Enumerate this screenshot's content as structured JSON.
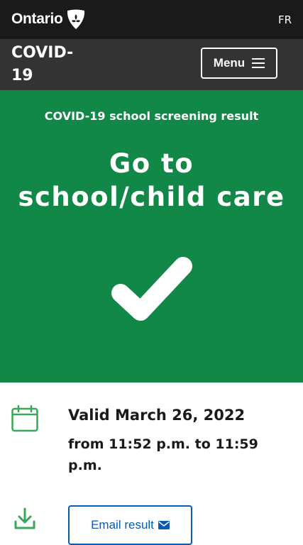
{
  "header": {
    "logo_text": "Ontario",
    "lang_link": "FR",
    "site_title": "COVID-19",
    "menu_label": "Menu"
  },
  "result": {
    "label": "COVID-19 school screening result",
    "headline_line1": "Go to",
    "headline_line2": "school/child care",
    "status_color": "#118847",
    "icon": "checkmark-icon"
  },
  "details": {
    "valid_date": "Valid March 26, 2022",
    "valid_time": "from 11:52 p.m. to 11:59 p.m.",
    "date_icon": "calendar-icon",
    "download_icon": "download-icon",
    "email_button": "Email result",
    "email_icon": "envelope-icon"
  }
}
